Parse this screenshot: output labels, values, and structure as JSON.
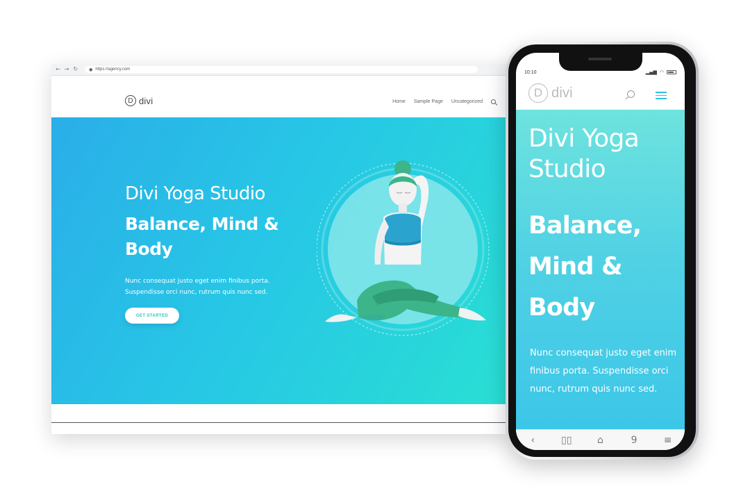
{
  "desktop": {
    "browser": {
      "url": "https://agency.com",
      "nav_back": "←",
      "nav_forward": "→",
      "nav_reload": "↻",
      "lock": "🔒"
    },
    "logo": {
      "mark": "D",
      "text": "divi"
    },
    "menu": {
      "items": [
        "Home",
        "Sample Page",
        "Uncategorized"
      ]
    },
    "hero": {
      "title": "Divi Yoga Studio",
      "subtitle": "Balance, Mind & Body",
      "body": "Nunc consequat justo eget enim finibus porta. Suspendisse orci nunc, rutrum quis nunc sed.",
      "cta": "GET STARTED"
    }
  },
  "mobile": {
    "status": {
      "time": "10:10"
    },
    "logo": {
      "mark": "D",
      "text": "divi"
    },
    "hero": {
      "title": "Divi Yoga Studio",
      "subtitle": "Balance, Mind & Body",
      "body": "Nunc consequat justo eget enim finibus porta. Suspendisse orci nunc, rutrum quis nunc sed."
    },
    "toolbar": {
      "back": "‹",
      "bookmarks": "▯▯",
      "home": "⌂",
      "tabs": "9",
      "menu": "≡"
    }
  },
  "colors": {
    "hero_start": "#2aaee8",
    "hero_end": "#29dfd4",
    "mobile_hero_top": "#6ee3de",
    "cta_text": "#27c6b9",
    "hamburger": "#2ec0e3",
    "top_blue": "#2ba3cf",
    "pants_green": "#3cb58a"
  }
}
